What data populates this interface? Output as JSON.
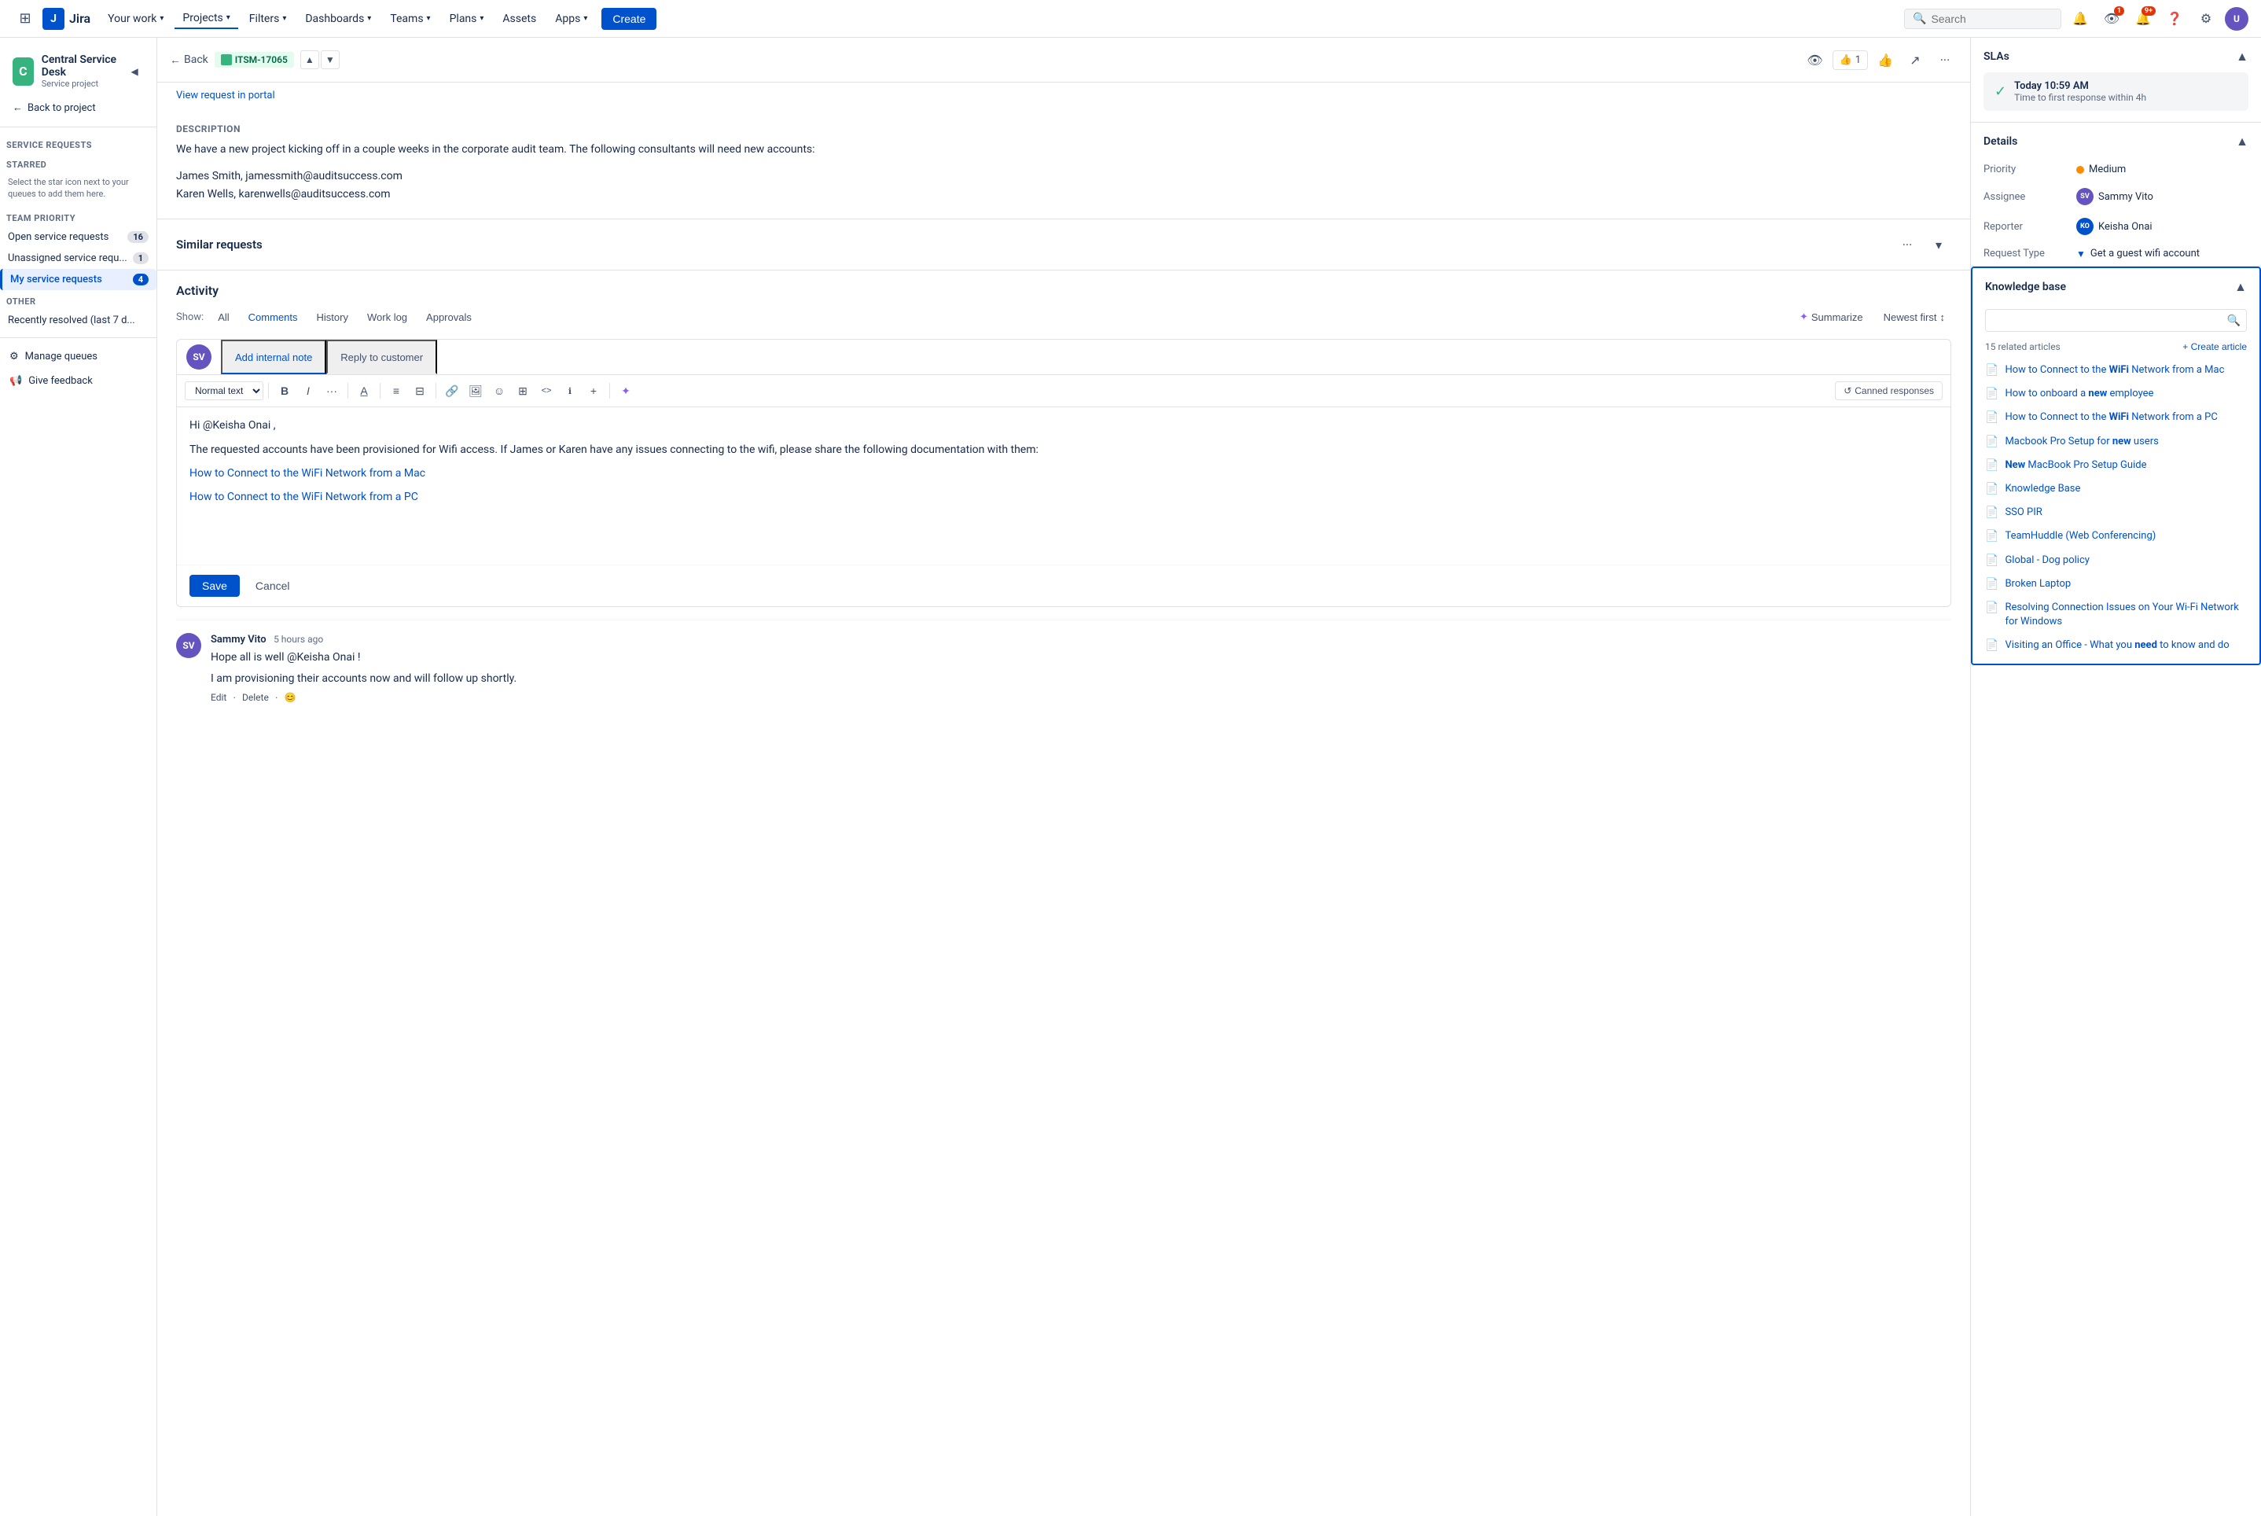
{
  "topNav": {
    "logoText": "Jira",
    "items": [
      {
        "id": "your-work",
        "label": "Your work",
        "hasChevron": true
      },
      {
        "id": "projects",
        "label": "Projects",
        "hasChevron": true,
        "active": true
      },
      {
        "id": "filters",
        "label": "Filters",
        "hasChevron": true
      },
      {
        "id": "dashboards",
        "label": "Dashboards",
        "hasChevron": true
      },
      {
        "id": "teams",
        "label": "Teams",
        "hasChevron": true
      },
      {
        "id": "plans",
        "label": "Plans",
        "hasChevron": true
      },
      {
        "id": "assets",
        "label": "Assets",
        "hasChevron": false
      },
      {
        "id": "apps",
        "label": "Apps",
        "hasChevron": true
      }
    ],
    "createLabel": "Create",
    "searchPlaceholder": "Search",
    "notificationBadge": "9+"
  },
  "sidebar": {
    "projectName": "Central Service Desk",
    "projectType": "Service project",
    "backToProject": "Back to project",
    "serviceRequestsTitle": "Service requests",
    "starredTitle": "STARRED",
    "starredHelp": "Select the star icon next to your queues to add them here.",
    "teamPriorityTitle": "TEAM PRIORITY",
    "queues": [
      {
        "id": "open",
        "label": "Open service requests",
        "count": "16"
      },
      {
        "id": "unassigned",
        "label": "Unassigned service requ...",
        "count": "1"
      },
      {
        "id": "my",
        "label": "My service requests",
        "count": "4",
        "active": true
      }
    ],
    "otherTitle": "OTHER",
    "otherItems": [
      {
        "id": "recently-resolved",
        "label": "Recently resolved (last 7 d..."
      }
    ],
    "footerItems": [
      {
        "id": "manage-queues",
        "label": "Manage queues",
        "icon": "⚙"
      },
      {
        "id": "give-feedback",
        "label": "Give feedback",
        "icon": "📢"
      }
    ]
  },
  "ticketHeader": {
    "backLabel": "Back",
    "ticketId": "ITSM-17065",
    "viewPortalLabel": "View request in portal"
  },
  "description": {
    "label": "Description",
    "text": "We have a new project kicking off in a couple weeks in the corporate audit team. The following consultants will need new accounts:",
    "contacts": [
      "James Smith, jamessmith@auditsuccess.com",
      "Karen Wells, karenwells@auditsuccess.com"
    ]
  },
  "similarRequests": {
    "title": "Similar requests"
  },
  "activity": {
    "title": "Activity",
    "showLabel": "Show:",
    "tabs": [
      {
        "id": "all",
        "label": "All"
      },
      {
        "id": "comments",
        "label": "Comments",
        "active": true
      },
      {
        "id": "history",
        "label": "History"
      },
      {
        "id": "worklog",
        "label": "Work log"
      },
      {
        "id": "approvals",
        "label": "Approvals"
      }
    ],
    "summarizeLabel": "Summarize",
    "newestFirstLabel": "Newest first"
  },
  "commentEditor": {
    "tabs": [
      {
        "id": "internal",
        "label": "Add internal note",
        "active": true
      },
      {
        "id": "reply",
        "label": "Reply to customer"
      }
    ],
    "toolbarItems": [
      {
        "id": "text-style",
        "label": "Normal text",
        "type": "select"
      },
      {
        "id": "bold",
        "label": "B",
        "type": "button"
      },
      {
        "id": "italic",
        "label": "I",
        "type": "button"
      },
      {
        "id": "more",
        "label": "···",
        "type": "button"
      },
      {
        "id": "text-color",
        "label": "A",
        "type": "button"
      },
      {
        "id": "bullet-list",
        "label": "☰",
        "type": "button"
      },
      {
        "id": "numbered-list",
        "label": "≡",
        "type": "button"
      },
      {
        "id": "link",
        "label": "🔗",
        "type": "button"
      },
      {
        "id": "image",
        "label": "🖼",
        "type": "button"
      },
      {
        "id": "emoji",
        "label": "☺",
        "type": "button"
      },
      {
        "id": "table",
        "label": "⊞",
        "type": "button"
      },
      {
        "id": "code",
        "label": "<>",
        "type": "button"
      },
      {
        "id": "info",
        "label": "ℹ",
        "type": "button"
      },
      {
        "id": "more2",
        "label": "+",
        "type": "button"
      }
    ],
    "cannedResponsesLabel": "Canned responses",
    "content": {
      "greeting": "Hi @Keisha Onai ,",
      "body": "The requested accounts have been provisioned for Wifi access. If James or Karen have any issues connecting to the wifi, please share the following documentation with them:",
      "links": [
        "How to Connect to the WiFi Network from a Mac",
        "How to Connect to the WiFi Network from a PC"
      ]
    },
    "saveLabel": "Save",
    "cancelLabel": "Cancel"
  },
  "comments": [
    {
      "id": "comment-1",
      "author": "Sammy Vito",
      "time": "5 hours ago",
      "avatarInitials": "SV",
      "avatarColor": "#6554c0",
      "text1": "Hope all is well @Keisha Onai !",
      "text2": "I am provisioning their accounts now and will follow up shortly.",
      "actions": [
        "Edit",
        "Delete"
      ]
    }
  ],
  "rightPanel": {
    "slas": {
      "title": "SLAs",
      "card": {
        "time": "Today 10:59 AM",
        "description": "Time to first response within 4h"
      }
    },
    "details": {
      "title": "Details",
      "fields": [
        {
          "id": "priority",
          "label": "Priority",
          "value": "Medium"
        },
        {
          "id": "assignee",
          "label": "Assignee",
          "value": "Sammy Vito"
        },
        {
          "id": "reporter",
          "label": "Reporter",
          "value": "Keisha Onai"
        },
        {
          "id": "request-type",
          "label": "Request Type",
          "value": "Get a guest wifi account"
        }
      ]
    },
    "knowledgeBase": {
      "title": "Knowledge base",
      "searchPlaceholder": "",
      "relatedCount": "15 related articles",
      "createArticleLabel": "+ Create article",
      "articles": [
        {
          "id": "art-1",
          "title": "How to Connect to the ",
          "bold": "WiFi",
          "rest": " Network from a Mac"
        },
        {
          "id": "art-2",
          "title": "How to onboard a ",
          "bold": "new",
          "rest": " employee"
        },
        {
          "id": "art-3",
          "title": "How to Connect to the ",
          "bold": "WiFi",
          "rest": " Network from a PC"
        },
        {
          "id": "art-4",
          "title": "Macbook Pro Setup for ",
          "bold": "new",
          "rest": " users"
        },
        {
          "id": "art-5",
          "title": "",
          "bold": "New",
          "rest": " MacBook Pro Setup Guide"
        },
        {
          "id": "art-6",
          "title": "Knowledge Base",
          "bold": "",
          "rest": ""
        },
        {
          "id": "art-7",
          "title": "SSO PIR",
          "bold": "",
          "rest": ""
        },
        {
          "id": "art-8",
          "title": "TeamHuddle (Web Conferencing)",
          "bold": "",
          "rest": ""
        },
        {
          "id": "art-9",
          "title": "Global - Dog policy",
          "bold": "",
          "rest": ""
        },
        {
          "id": "art-10",
          "title": "Broken Laptop",
          "bold": "",
          "rest": ""
        },
        {
          "id": "art-11",
          "title": "Resolving Connection Issues on Your Wi-Fi Network for Windows",
          "bold": "",
          "rest": ""
        },
        {
          "id": "art-12",
          "title": "Visiting an Office - What you ",
          "bold": "need",
          "rest": " to know and do"
        }
      ]
    }
  }
}
